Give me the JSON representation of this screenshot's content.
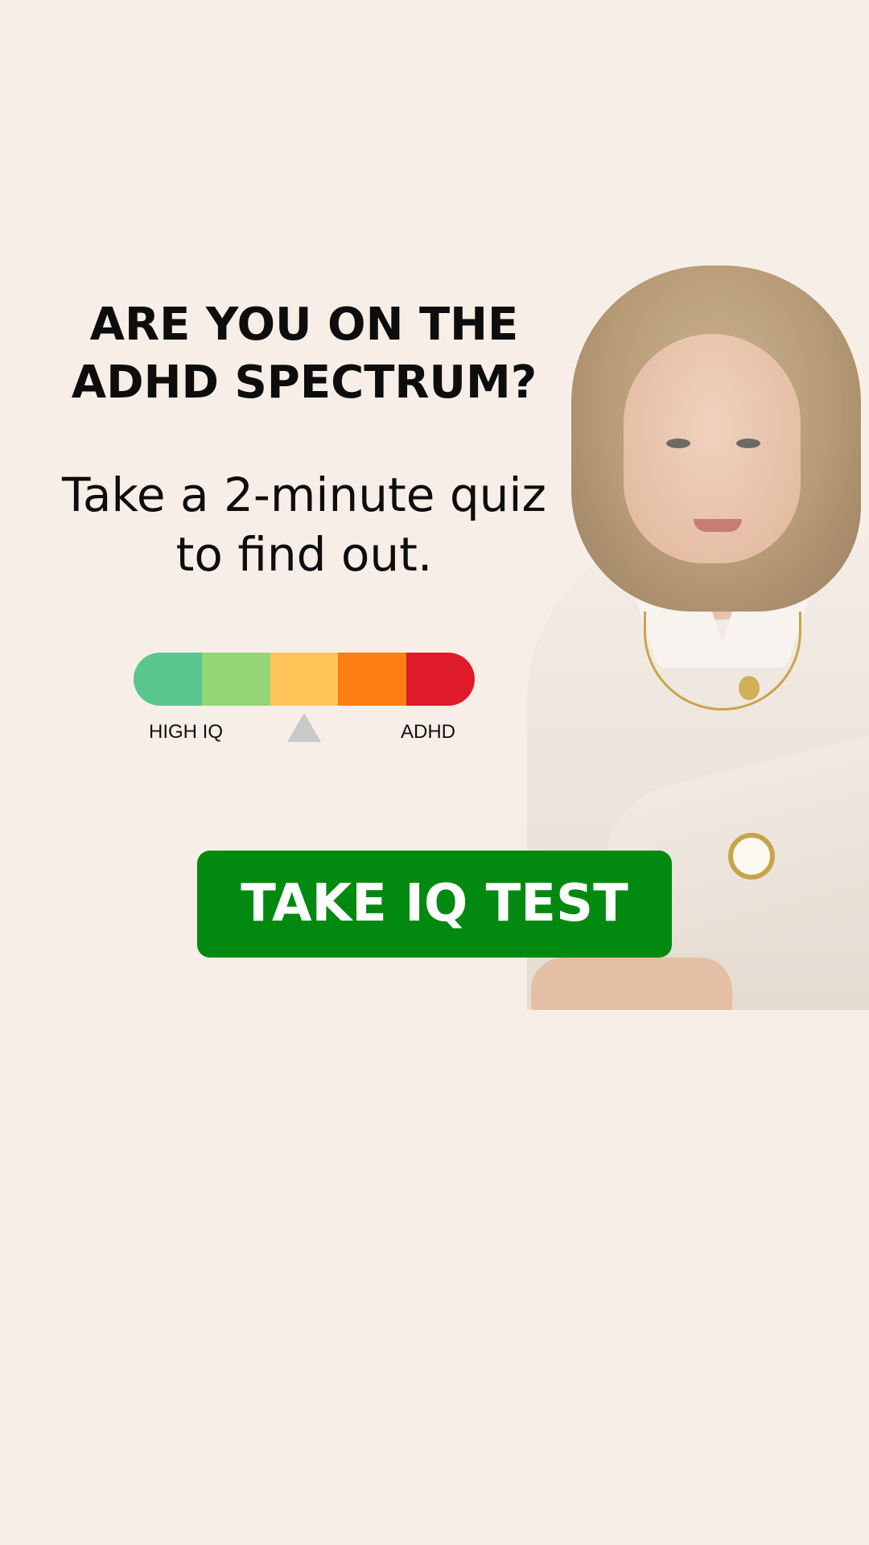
{
  "headline": {
    "line1": "ARE YOU ON THE",
    "line2": "ADHD SPECTRUM?"
  },
  "subhead": {
    "line1": "Take a 2-minute quiz",
    "line2": "to find out."
  },
  "spectrum": {
    "segment_colors": [
      "#58c68e",
      "#94d676",
      "#fdc558",
      "#fd7e12",
      "#df1a2a"
    ],
    "left_label": "HIGH IQ",
    "right_label": "ADHD",
    "pointer_position": 0.5
  },
  "cta": {
    "label": "TAKE IQ TEST",
    "color": "#028a10"
  },
  "colors": {
    "background": "#f7efe7",
    "text": "#0d0d0d",
    "pointer": "#c9c9c7"
  }
}
